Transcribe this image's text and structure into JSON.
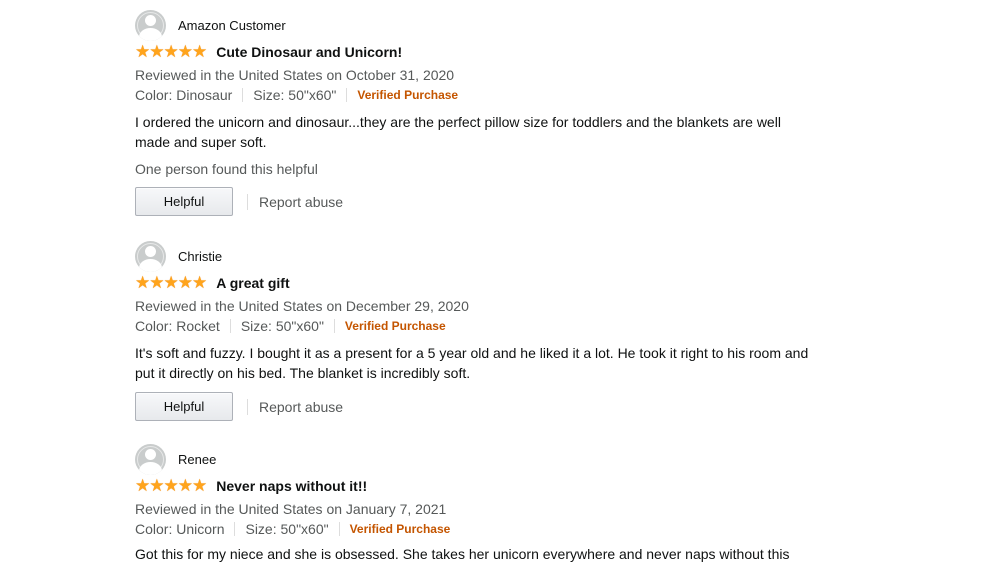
{
  "reviews": [
    {
      "name": "Amazon Customer",
      "rating": 5,
      "title": "Cute Dinosaur and Unicorn!",
      "date": "Reviewed in the United States on October 31, 2020",
      "color": "Color: Dinosaur",
      "size": "Size: 50\"x60\"",
      "verified": "Verified Purchase",
      "text": "I ordered the unicorn and dinosaur...they are the perfect pillow size for toddlers and the blankets are well made and super soft.",
      "helpful_count": "One person found this helpful",
      "helpful_label": "Helpful",
      "report_label": "Report abuse"
    },
    {
      "name": "Christie",
      "rating": 5,
      "title": "A great gift",
      "date": "Reviewed in the United States on December 29, 2020",
      "color": "Color: Rocket",
      "size": "Size: 50\"x60\"",
      "verified": "Verified Purchase",
      "text": "It's soft and fuzzy. I bought it as a present for a 5 year old and he liked it a lot. He took it right to his room and put it directly on his bed. The blanket is incredibly soft.",
      "helpful_label": "Helpful",
      "report_label": "Report abuse"
    },
    {
      "name": "Renee",
      "rating": 5,
      "title": "Never naps without it!!",
      "date": "Reviewed in the United States on January 7, 2021",
      "color": "Color: Unicorn",
      "size": "Size: 50\"x60\"",
      "verified": "Verified Purchase",
      "text": "Got this for my niece and she is obsessed. She takes her unicorn everywhere and never naps without this"
    }
  ],
  "colors": {
    "star": "#ffa41c",
    "verified": "#c45500",
    "muted": "#565959"
  }
}
